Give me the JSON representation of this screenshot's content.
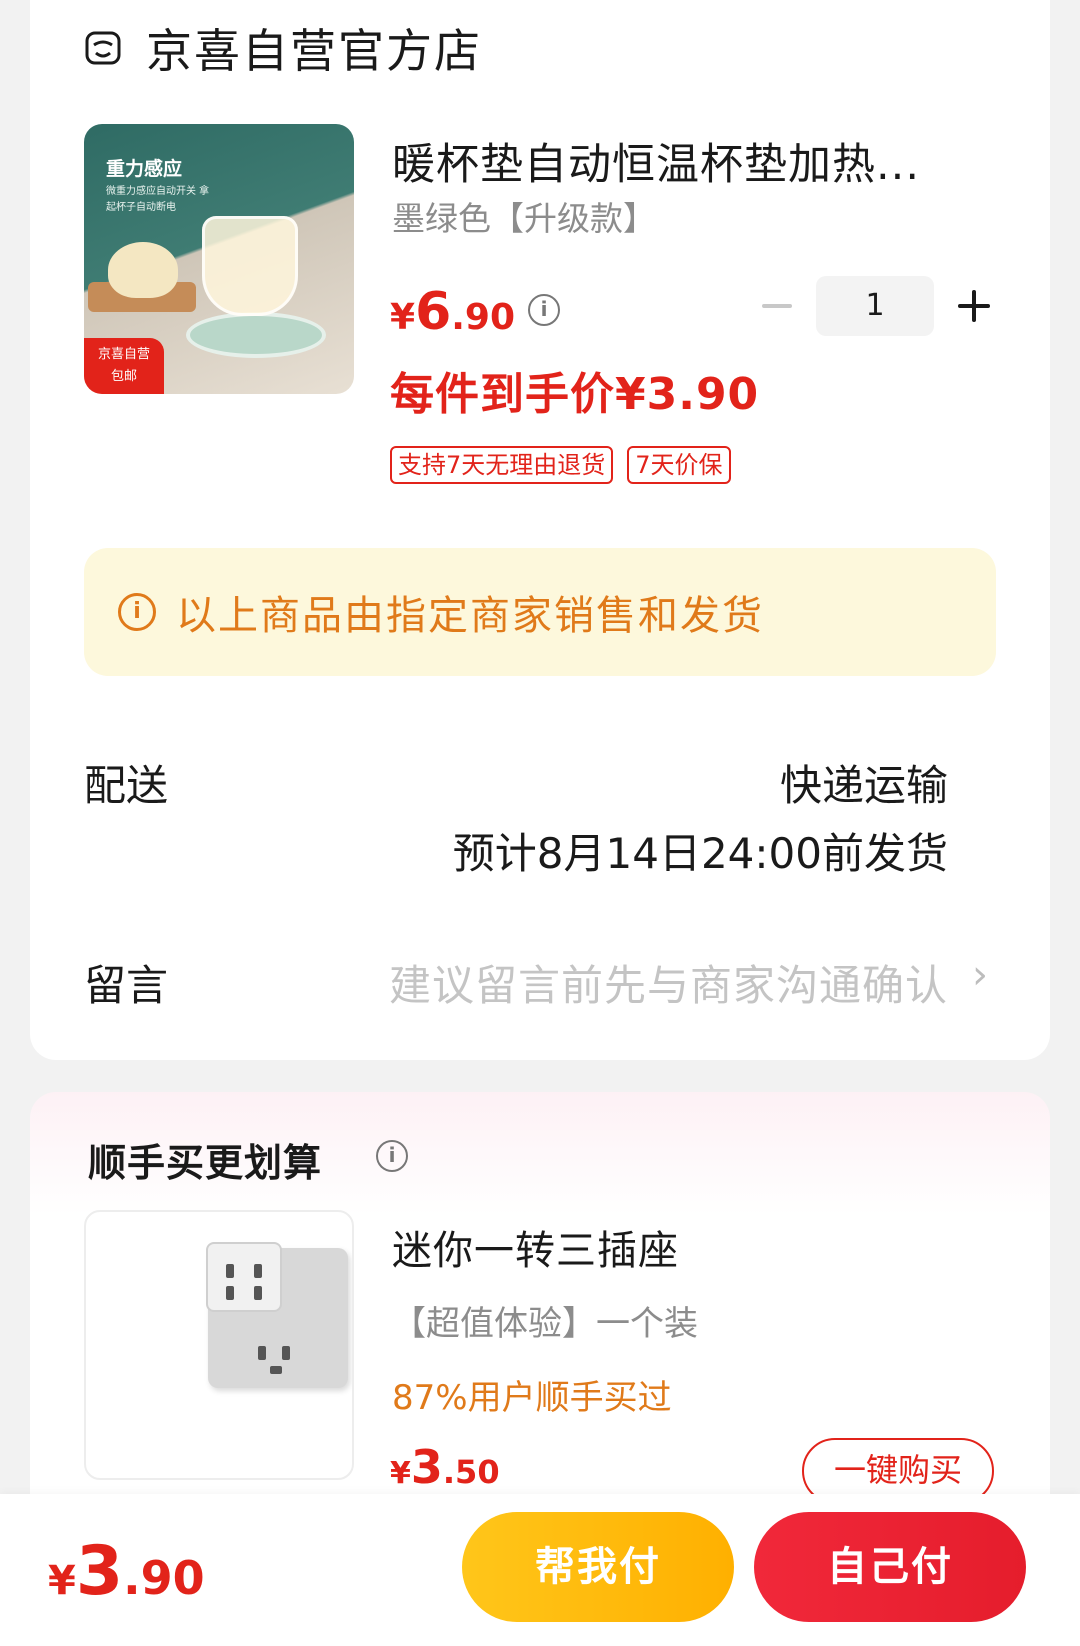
{
  "store": {
    "name": "京喜自营官方店",
    "icon": "store-icon"
  },
  "product": {
    "title": "暖杯垫自动恒温杯垫加热...",
    "spec": "墨绿色【升级款】",
    "price_symbol": "¥",
    "price_int": "6",
    "price_dec": ".90",
    "final_price": "每件到手价¥3.90",
    "quantity": "1",
    "thumb_title": "重力感应",
    "thumb_sub": "微重力感应自动开关 拿起杯子自动断电",
    "thumb_badge_1": "京喜自营",
    "thumb_badge_2": "包邮",
    "tags": [
      "支持7天无理由退货",
      "7天价保"
    ]
  },
  "notice": {
    "text": "以上商品由指定商家销售和发货"
  },
  "shipping": {
    "label": "配送",
    "method": "快递运输",
    "eta": "预计8月14日24:00前发货"
  },
  "message": {
    "label": "留言",
    "placeholder": "建议留言前先与商家沟通确认",
    "chevron": "›"
  },
  "recommend": {
    "title": "顺手买更划算",
    "item": {
      "name": "迷你一转三插座",
      "spec": "【超值体验】一个装",
      "stat": "87%用户顺手买过",
      "price_symbol": "¥",
      "price_int": "3",
      "price_dec": ".50",
      "button": "一键购买"
    }
  },
  "footer": {
    "total_symbol": "¥",
    "total_int": "3",
    "total_dec": ".90",
    "help_pay": "帮我付",
    "self_pay": "自己付"
  },
  "colors": {
    "accent": "#e2231a",
    "warning": "#e07a1a",
    "help_btn": "#ffc61a",
    "notice_bg": "#fdf8dc"
  }
}
